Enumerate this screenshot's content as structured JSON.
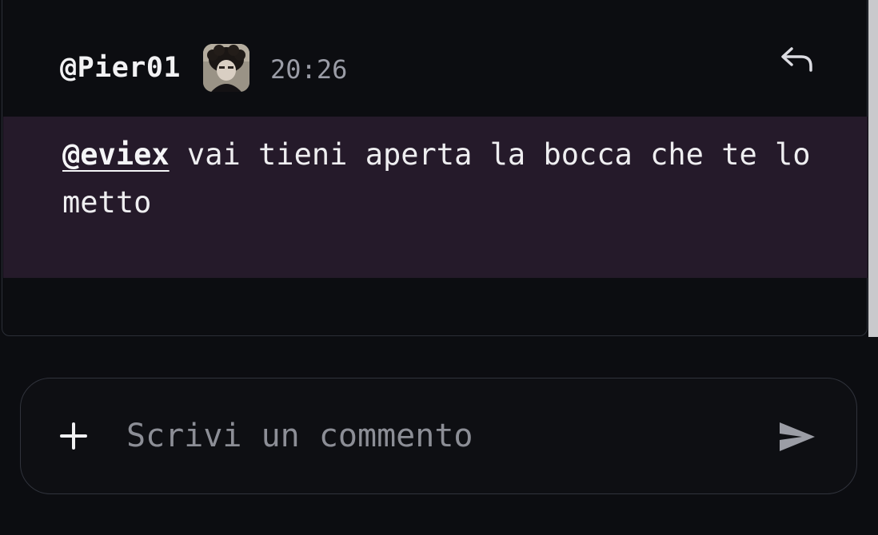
{
  "comment": {
    "author": "@Pier01",
    "timestamp": "20:26",
    "mention": "@eviex",
    "text": " vai tieni aperta la bocca che te lo metto",
    "reply_icon": "reply-icon",
    "avatar_icon": "user-avatar"
  },
  "composer": {
    "placeholder": "Scrivi un commento",
    "add_icon": "plus-icon",
    "send_icon": "send-icon"
  },
  "colors": {
    "background": "#0c0d11",
    "highlight_background": "#251a2a",
    "text": "#eeeef0",
    "muted_text": "#9a9ca6"
  }
}
